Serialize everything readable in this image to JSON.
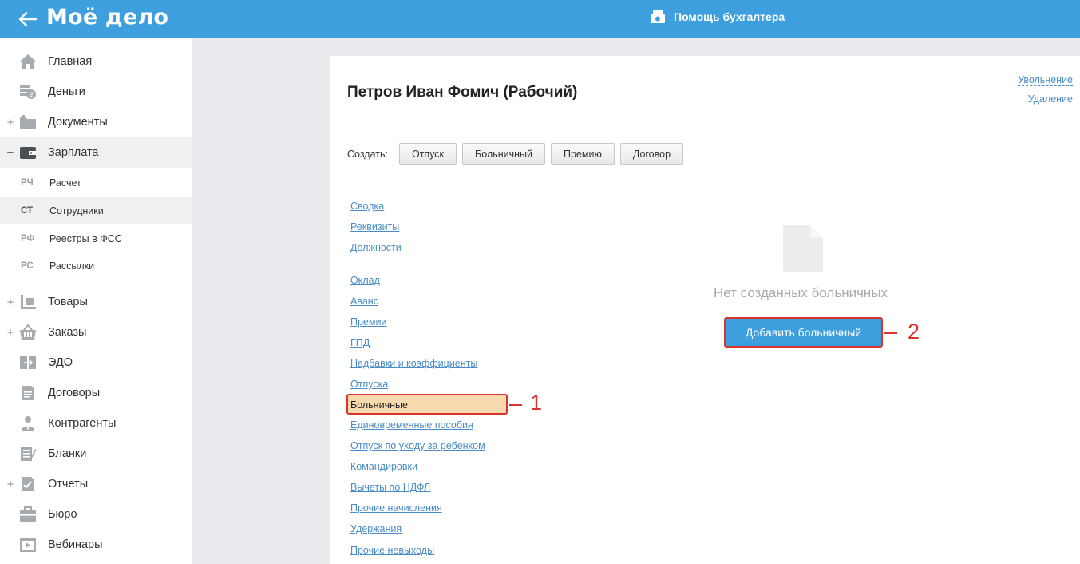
{
  "app": {
    "logo": "Моё дело",
    "help_label": "Помощь бухгалтера"
  },
  "sidebar": {
    "items": [
      {
        "label": "Главная",
        "toggle": "",
        "icon": "home-icon"
      },
      {
        "label": "Деньги",
        "toggle": "",
        "icon": "money-icon"
      },
      {
        "label": "Документы",
        "toggle": "+",
        "icon": "folder-icon"
      },
      {
        "label": "Зарплата",
        "toggle": "−",
        "icon": "wallet-icon",
        "active": true
      }
    ],
    "subitems": [
      {
        "abbr": "РЧ",
        "label": "Расчет"
      },
      {
        "abbr": "СТ",
        "label": "Сотрудники",
        "active": true
      },
      {
        "abbr": "РФ",
        "label": "Реестры в ФСС"
      },
      {
        "abbr": "РС",
        "label": "Рассылки"
      }
    ],
    "items_after": [
      {
        "label": "Товары",
        "toggle": "+",
        "icon": "goods-icon"
      },
      {
        "label": "Заказы",
        "toggle": "+",
        "icon": "basket-icon"
      },
      {
        "label": "ЭДО",
        "toggle": "",
        "icon": "edo-icon"
      },
      {
        "label": "Договоры",
        "toggle": "",
        "icon": "contract-icon"
      },
      {
        "label": "Контрагенты",
        "toggle": "",
        "icon": "person-icon"
      },
      {
        "label": "Бланки",
        "toggle": "",
        "icon": "forms-icon"
      },
      {
        "label": "Отчеты",
        "toggle": "+",
        "icon": "report-icon"
      },
      {
        "label": "Бюро",
        "toggle": "",
        "icon": "briefcase-icon"
      },
      {
        "label": "Вебинары",
        "toggle": "",
        "icon": "webinar-icon"
      }
    ]
  },
  "employee": {
    "title": "Петров Иван Фомич (Рабочий)"
  },
  "top_links": {
    "dismiss": "Увольнение",
    "delete": "Удаление"
  },
  "create": {
    "label": "Создать:",
    "buttons": [
      "Отпуск",
      "Больничный",
      "Премию",
      "Договор"
    ]
  },
  "tabs": [
    "Сводка",
    "Реквизиты",
    "Должности",
    "Оклад",
    "Аванс",
    "Премии",
    "ГПД",
    "Надбавки и коэффициенты",
    "Отпуска",
    "Больничные",
    "Единовременные пособия",
    "Отпуск по уходу за ребенком",
    "Командировки",
    "Вычеты по НДФЛ",
    "Прочие начисления",
    "Удержания",
    "Прочие невыходы"
  ],
  "selected_tab": "Больничные",
  "empty_state": {
    "text": "Нет созданных больничных",
    "button": "Добавить больничный"
  },
  "callouts": {
    "one": "1",
    "two": "2"
  },
  "colors": {
    "topbar": "#3d9fde",
    "annotation": "#d9342b",
    "link": "#4a8cc7",
    "highlight": "#f6d9ad"
  }
}
